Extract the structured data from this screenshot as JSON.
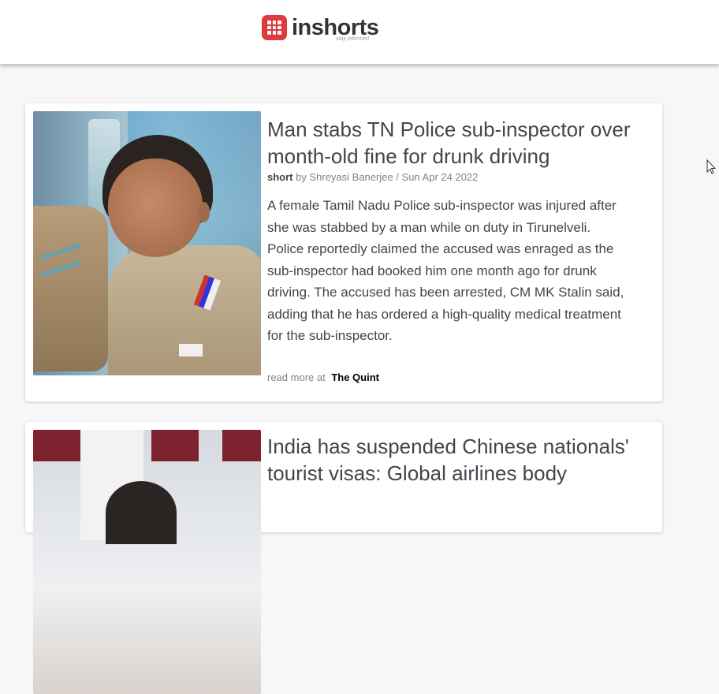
{
  "header": {
    "logo_text": "inshorts",
    "tagline": "stay informed"
  },
  "articles": [
    {
      "title": "Man stabs TN Police sub-inspector over month-old fine for drunk driving",
      "short_label": "short",
      "byline": "by Shreyasi Banerjee / Sun Apr 24 2022",
      "content": "A female Tamil Nadu Police sub-inspector was injured after she was stabbed by a man while on duty in Tirunelveli. Police reportedly claimed the accused was enraged as the sub-inspector had booked him one month ago for drunk driving. The accused has been arrested, CM MK Stalin said, adding that he has ordered a high-quality medical treatment for the sub-inspector.",
      "read_more_label": "read more at",
      "source": "The Quint"
    },
    {
      "title": "India has suspended Chinese nationals' tourist visas: Global airlines body"
    }
  ],
  "colors": {
    "brand_red": "#e03a3e",
    "title_text": "#44444d",
    "meta_text": "#808290"
  }
}
